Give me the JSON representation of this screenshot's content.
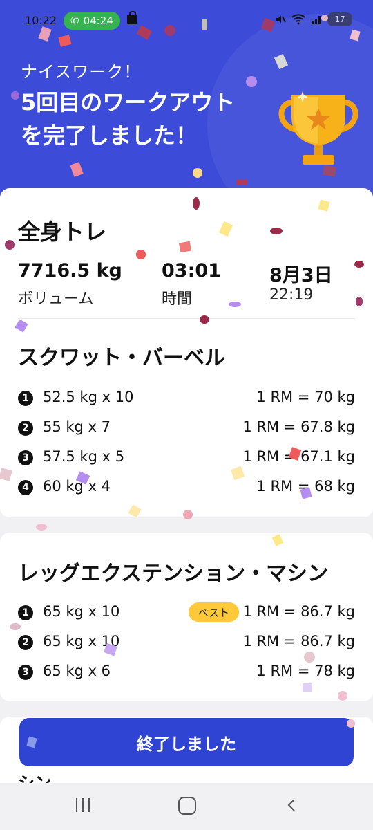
{
  "status_bar": {
    "time": "10:22",
    "call_timer": "04:24",
    "battery": "17"
  },
  "header": {
    "subtitle": "ナイスワーク！",
    "title": "5回目のワークアウトを完了しました！"
  },
  "summary": {
    "workout_name": "全身トレ",
    "volume_value": "7716.5 kg",
    "volume_label": "ボリューム",
    "duration_value": "03:01",
    "duration_label": "時間",
    "date_value": "8月3日",
    "date_time": "22:19"
  },
  "exercises": [
    {
      "name": "スクワット・バーベル",
      "sets": [
        {
          "num": "1",
          "text": "52.5 kg x 10",
          "rm": "1 RM = 70 kg"
        },
        {
          "num": "2",
          "text": "55 kg x 7",
          "rm": "1 RM = 67.8 kg"
        },
        {
          "num": "3",
          "text": "57.5 kg x 5",
          "rm": "1 RM = 67.1 kg"
        },
        {
          "num": "4",
          "text": "60 kg x 4",
          "rm": "1 RM = 68 kg"
        }
      ]
    },
    {
      "name": "レッグエクステンション・マシン",
      "best_label": "ベスト",
      "sets": [
        {
          "num": "1",
          "text": "65 kg x 10",
          "rm": "1 RM = 86.7 kg"
        },
        {
          "num": "2",
          "text": "65 kg x 10",
          "rm": "1 RM = 86.7 kg"
        },
        {
          "num": "3",
          "text": "65 kg x 6",
          "rm": "1 RM = 78 kg"
        }
      ]
    }
  ],
  "finish_button": "終了しました",
  "peek_text": "シン",
  "colors": {
    "header_bg": "#3c4bd8",
    "button_bg": "#3044d4",
    "best_badge": "#ffc93a",
    "call_green": "#35b34f"
  }
}
